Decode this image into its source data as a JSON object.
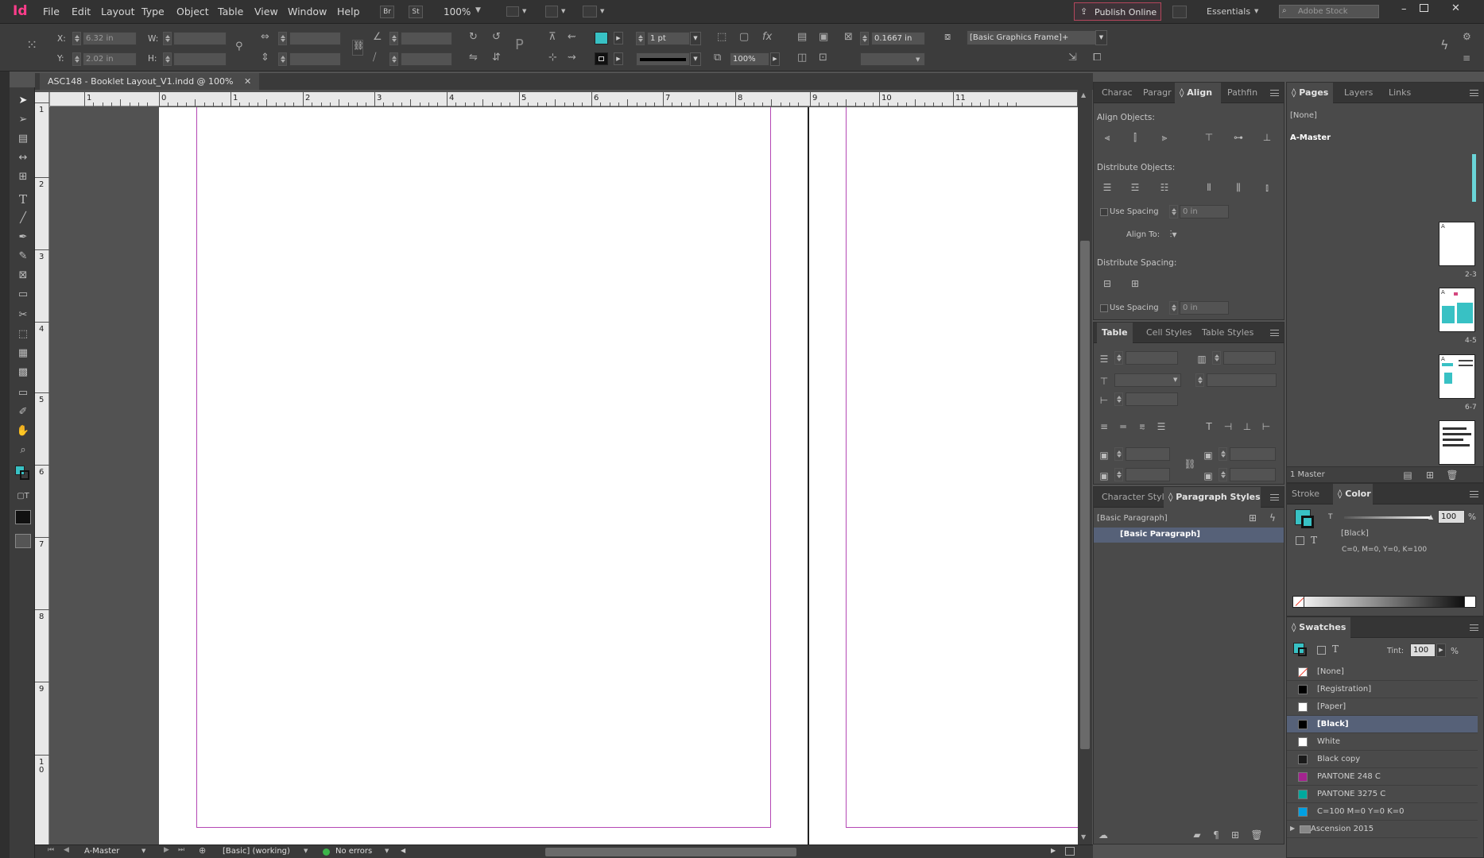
{
  "app": {
    "logo": "Id",
    "zoom": "100%",
    "bridge": "Br",
    "stock_btn": "St",
    "publish": "Publish Online",
    "workspace": "Essentials",
    "search_placeholder": "Adobe Stock"
  },
  "menu": [
    "File",
    "Edit",
    "Layout",
    "Type",
    "Object",
    "Table",
    "View",
    "Window",
    "Help"
  ],
  "control": {
    "x_label": "X:",
    "x": "6.32 in",
    "y_label": "Y:",
    "y": "2.02 in",
    "w_label": "W:",
    "h_label": "H:",
    "stroke_weight": "1 pt",
    "opacity": "100%",
    "ref_value": "0.1667 in",
    "object_style": "[Basic Graphics Frame]+",
    "fill_color": "#38c1c4"
  },
  "document": {
    "tab_title": "ASC148 - Booklet Layout_V1.indd @ 100%",
    "ruler_h": [
      "1",
      "0",
      "1",
      "2",
      "3",
      "4",
      "5",
      "6",
      "7",
      "8",
      "9",
      "10",
      "11"
    ],
    "ruler_v": [
      "1",
      "2",
      "3",
      "4",
      "5",
      "6",
      "7",
      "8",
      "9",
      "1\n0"
    ]
  },
  "status": {
    "page": "A-Master",
    "preflight_profile": "[Basic] (working)",
    "errors": "No errors"
  },
  "align_panel": {
    "tabs": [
      "Charac",
      "Paragr",
      "Align",
      "Pathfin"
    ],
    "align_objects": "Align Objects:",
    "distribute_objects": "Distribute Objects:",
    "use_spacing": "Use Spacing",
    "spacing_value": "0 in",
    "align_to": "Align To:",
    "distribute_spacing": "Distribute Spacing:"
  },
  "table_panel": {
    "tabs": [
      "Table",
      "Cell Styles",
      "Table Styles"
    ]
  },
  "para_panel": {
    "tabs": [
      "Character Styl",
      "Paragraph Styles"
    ],
    "current": "[Basic Paragraph]",
    "items": [
      "[Basic Paragraph]"
    ]
  },
  "pages_panel": {
    "tabs": [
      "Pages",
      "Layers",
      "Links"
    ],
    "none": "[None]",
    "master": "A-Master",
    "labels": [
      "2-3",
      "4-5",
      "6-7"
    ],
    "a_marks": [
      "A",
      "A",
      "A"
    ],
    "footer": "1 Master"
  },
  "color_panel": {
    "tabs": [
      "Stroke",
      "Color"
    ],
    "tint": "100",
    "pct": "%",
    "swatch": "[Black]",
    "formula": "C=0, M=0, Y=0, K=100",
    "t_label": "T"
  },
  "swatches_panel": {
    "title": "Swatches",
    "tint_label": "Tint:",
    "tint": "100",
    "pct": "%",
    "items": [
      {
        "name": "[None]",
        "color": "#ffffff",
        "none": true
      },
      {
        "name": "[Registration]",
        "color": "#000000"
      },
      {
        "name": "[Paper]",
        "color": "#ffffff"
      },
      {
        "name": "[Black]",
        "color": "#000000",
        "selected": true
      },
      {
        "name": "White",
        "color": "#ffffff"
      },
      {
        "name": "Black copy",
        "color": "#1a1a1a"
      },
      {
        "name": "PANTONE 248 C",
        "color": "#a3248f"
      },
      {
        "name": "PANTONE 3275 C",
        "color": "#00a99d"
      },
      {
        "name": "C=100 M=0 Y=0 K=0",
        "color": "#00a0e3"
      },
      {
        "name": "Ascension 2015",
        "color": "#888888",
        "folder": true
      }
    ]
  }
}
